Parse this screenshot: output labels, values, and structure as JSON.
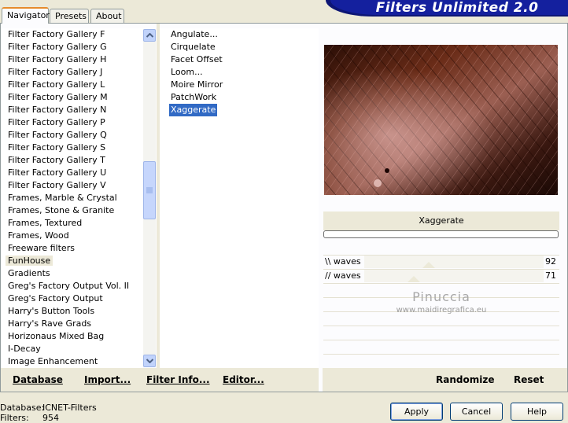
{
  "window": {
    "title": "Filters Unlimited 2.0"
  },
  "tabs": [
    {
      "label": "Navigator",
      "active": true
    },
    {
      "label": "Presets",
      "active": false
    },
    {
      "label": "About",
      "active": false
    }
  ],
  "categories": [
    "Filter Factory Gallery F",
    "Filter Factory Gallery G",
    "Filter Factory Gallery H",
    "Filter Factory Gallery J",
    "Filter Factory Gallery L",
    "Filter Factory Gallery M",
    "Filter Factory Gallery N",
    "Filter Factory Gallery P",
    "Filter Factory Gallery Q",
    "Filter Factory Gallery S",
    "Filter Factory Gallery T",
    "Filter Factory Gallery U",
    "Filter Factory Gallery V",
    "Frames, Marble & Crystal",
    "Frames, Stone & Granite",
    "Frames, Textured",
    "Frames, Wood",
    "Freeware filters",
    "FunHouse",
    "Gradients",
    "Greg's Factory Output Vol. II",
    "Greg's Factory Output",
    "Harry's Button Tools",
    "Harry's Rave Grads",
    "Horizonaus Mixed Bag",
    "I-Decay",
    "Image Enhancement"
  ],
  "selected_category": "FunHouse",
  "filters": [
    "Angulate...",
    "Cirquelate",
    "Facet Offset",
    "Loom...",
    "Moire Mirror",
    "PatchWork",
    "Xaggerate"
  ],
  "selected_filter": "Xaggerate",
  "preview": {
    "filter_name": "Xaggerate"
  },
  "params": [
    {
      "label": "\\\\ waves",
      "value": "92",
      "level": 92
    },
    {
      "label": "// waves",
      "value": "71",
      "level": 71
    }
  ],
  "watermark": {
    "line1": "Pinuccia",
    "line2": "www.maidiregrafica.eu"
  },
  "bottom_buttons": {
    "database": "Database",
    "import": "Import...",
    "filter_info": "Filter Info...",
    "editor": "Editor...",
    "randomize": "Randomize",
    "reset": "Reset"
  },
  "status": {
    "database_label": "Database:",
    "database_value": "ICNET-Filters",
    "filters_label": "Filters:",
    "filters_value": "954"
  },
  "dialog_buttons": {
    "apply": "Apply",
    "cancel": "Cancel",
    "help": "Help"
  }
}
